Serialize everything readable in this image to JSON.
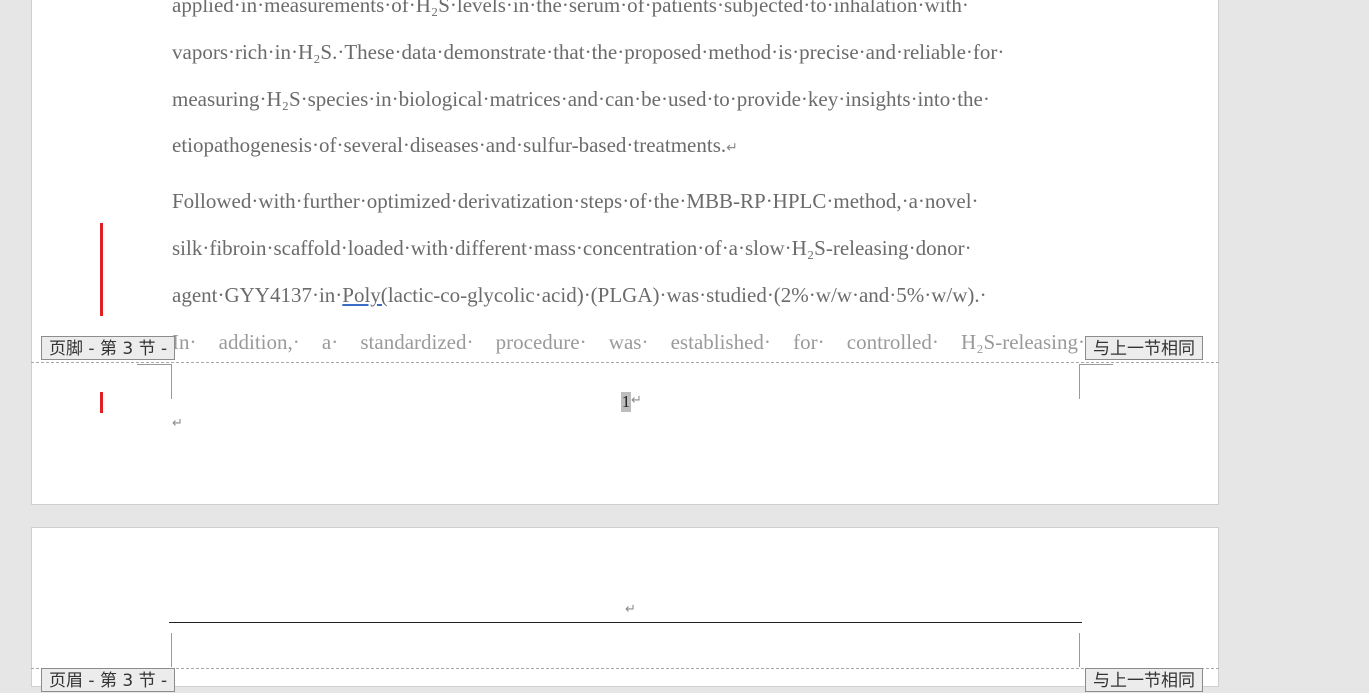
{
  "document": {
    "para1": {
      "line1": "applied·in·measurements·of·H₂S·levels·in·the·serum·of·patients·subjected·to·inhalation·with·",
      "line2": "vapors·rich·in·H₂S.·These·data·demonstrate·that·the·proposed·method·is·precise·and·reliable·for·",
      "line3": "measuring·H₂S·species·in·biological·matrices·and·can·be·used·to·provide·key·insights·into·the·",
      "line4": "etiopathogenesis·of·several·diseases·and·sulfur-based·treatments.",
      "end_mark": "↵"
    },
    "para2": {
      "line1": "Followed·with·further·optimized·derivatization·steps·of·the·MBB-RP·HPLC·method,·a·novel·",
      "line2": "silk·fibroin·scaffold·loaded·with·different·mass·concentration·of·a·slow·H₂S-releasing·donor·",
      "line3_pre": "agent·GYY4137·in·",
      "line3_link": "Poly(",
      "line3_post": "lactic-co-glycolic·acid)·(PLGA)·was·studied·(2%·w/w·and·5%·w/w).·",
      "line4": "In·  addition,·  a·  standardized·  procedure·  was·  established·  for·  controlled·  H₂S-releasing·"
    }
  },
  "footer": {
    "left_tab": "页脚 - 第 3 节 -",
    "right_tab": "与上一节相同",
    "page_number": "1",
    "num_mark": "↵",
    "empty_mark": "↵"
  },
  "next_page": {
    "header_mark": "↵",
    "left_tab": "页眉 - 第 3 节 -",
    "right_tab": "与上一节相同"
  },
  "colors": {
    "change_bar": "#e02020",
    "background": "#e6e6e6",
    "text": "#6b6b6b"
  }
}
